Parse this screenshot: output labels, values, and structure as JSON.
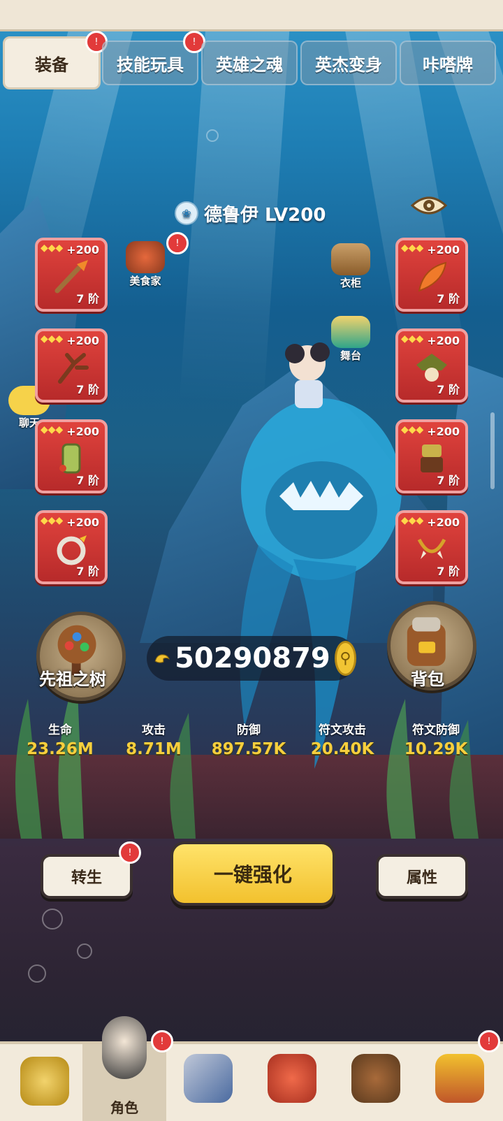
{
  "tabs": [
    {
      "label": "装备",
      "active": true,
      "badge": true
    },
    {
      "label": "技能玩具",
      "active": false,
      "badge": true
    },
    {
      "label": "英雄之魂",
      "active": false,
      "badge": false
    },
    {
      "label": "英杰变身",
      "active": false,
      "badge": false
    },
    {
      "label": "咔嗒牌",
      "active": false,
      "badge": false
    }
  ],
  "hero": {
    "class_icon": "druid-class-icon",
    "name": "德鲁伊 LV200"
  },
  "features": {
    "chef": "美食家",
    "wardrobe": "衣柜",
    "stage": "舞台",
    "chat": "聊天"
  },
  "left_slots": [
    {
      "plus": "+200",
      "rank": "7 阶",
      "icon": "carrot-staff-icon"
    },
    {
      "plus": "+200",
      "rank": "7 阶",
      "icon": "antler-branch-icon"
    },
    {
      "plus": "+200",
      "rank": "7 阶",
      "icon": "bamboo-bracer-icon"
    },
    {
      "plus": "+200",
      "rank": "7 阶",
      "icon": "fang-ring-icon"
    }
  ],
  "right_slots": [
    {
      "plus": "+200",
      "rank": "7 阶",
      "icon": "feather-icon"
    },
    {
      "plus": "+200",
      "rank": "7 阶",
      "icon": "leaf-helmet-icon"
    },
    {
      "plus": "+200",
      "rank": "7 阶",
      "icon": "tribal-armor-icon"
    },
    {
      "plus": "+200",
      "rank": "7 阶",
      "icon": "tooth-necklace-icon"
    }
  ],
  "ancestor_tree": "先祖之树",
  "backpack": "背包",
  "power": "50290879",
  "stats": [
    {
      "label": "生命",
      "value": "23.26M"
    },
    {
      "label": "攻击",
      "value": "8.71M"
    },
    {
      "label": "防御",
      "value": "897.57K"
    },
    {
      "label": "符文攻击",
      "value": "20.40K"
    },
    {
      "label": "符文防御",
      "value": "10.29K"
    }
  ],
  "actions": {
    "rebirth": "转生",
    "upgrade_all": "一键强化",
    "attributes": "属性"
  },
  "bottom_nav": [
    {
      "label": "",
      "icon": "viking-helmet-icon",
      "badge": false,
      "active": false
    },
    {
      "label": "角色",
      "icon": "hero-portrait-icon",
      "badge": true,
      "active": true
    },
    {
      "label": "",
      "icon": "sword-shield-icon",
      "badge": false,
      "active": false
    },
    {
      "label": "",
      "icon": "dino-pet-icon",
      "badge": false,
      "active": false
    },
    {
      "label": "",
      "icon": "beaver-shop-icon",
      "badge": false,
      "active": false
    },
    {
      "label": "",
      "icon": "tribe-totem-icon",
      "badge": true,
      "active": false
    }
  ],
  "colors": {
    "accent_yellow": "#f2c12e",
    "slot_red": "#d23a35",
    "badge_red": "#e23a3a",
    "stat_gold": "#f6cf3d"
  }
}
